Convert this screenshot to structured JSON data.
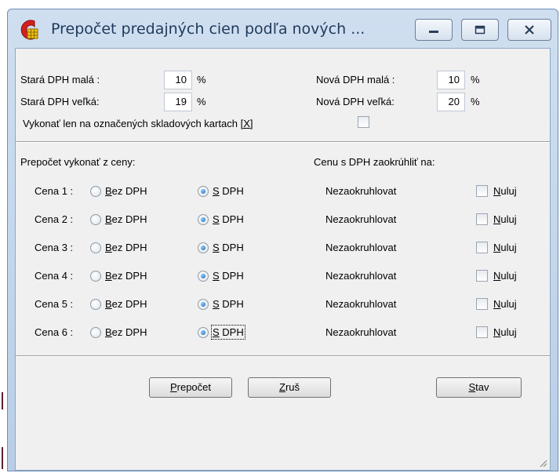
{
  "window": {
    "title": "Prepočet predajných cien podľa nových ...",
    "controls": [
      "minimize",
      "maximize",
      "close"
    ]
  },
  "vat": {
    "old_low_label": "Stará DPH malá :",
    "old_low_value": "10",
    "old_high_label": "Stará DPH veľká:",
    "old_high_value": "19",
    "new_low_label": "Nová DPH malá :",
    "new_low_value": "10",
    "new_high_label": "Nová DPH veľká:",
    "new_high_value": "20",
    "percent": "%"
  },
  "marked_only": {
    "label": "Vykonať len na označených skladových kartach",
    "hotkey": "[X]",
    "checked": false
  },
  "section": {
    "compute_from": "Prepočet vykonať z ceny:",
    "rounding": "Cenu s DPH zaokrúhliť na:"
  },
  "prices": [
    {
      "label": "Cena 1 :",
      "without_vat": "Bez DPH",
      "with_vat": "S DPH",
      "selected": "with_vat",
      "rounding": "Nezaokruhlovat",
      "zero_label": "Nuluj",
      "zero_checked": false
    },
    {
      "label": "Cena 2 :",
      "without_vat": "Bez DPH",
      "with_vat": "S DPH",
      "selected": "with_vat",
      "rounding": "Nezaokruhlovat",
      "zero_label": "Nuluj",
      "zero_checked": false
    },
    {
      "label": "Cena 3 :",
      "without_vat": "Bez DPH",
      "with_vat": "S DPH",
      "selected": "with_vat",
      "rounding": "Nezaokruhlovat",
      "zero_label": "Nuluj",
      "zero_checked": false
    },
    {
      "label": "Cena 4 :",
      "without_vat": "Bez DPH",
      "with_vat": "S DPH",
      "selected": "with_vat",
      "rounding": "Nezaokruhlovat",
      "zero_label": "Nuluj",
      "zero_checked": false
    },
    {
      "label": "Cena 5 :",
      "without_vat": "Bez DPH",
      "with_vat": "S DPH",
      "selected": "with_vat",
      "rounding": "Nezaokruhlovat",
      "zero_label": "Nuluj",
      "zero_checked": false
    },
    {
      "label": "Cena 6 :",
      "without_vat": "Bez DPH",
      "with_vat": "S DPH",
      "selected": "with_vat",
      "rounding": "Nezaokruhlovat",
      "zero_label": "Nuluj",
      "zero_checked": false,
      "focused": true
    }
  ],
  "buttons": {
    "recalc_hot": "P",
    "recalc_rest": "repočet",
    "cancel_hot": "Z",
    "cancel_rest": "ruš",
    "status_hot": "S",
    "status_rest": "tav"
  },
  "colors": {
    "title_text": "#1f3a5a",
    "window_frame": "#b9cee6",
    "dialog_bg": "#f0f0f0",
    "radio_selected": "#1a5fb0",
    "app_icon_red": "#d42020",
    "app_icon_yellow": "#f2c21a"
  },
  "icons": {
    "app": "app-icon",
    "minimize": "minimize-icon",
    "maximize": "maximize-icon",
    "close": "close-icon",
    "resize": "resize-grip-icon"
  }
}
